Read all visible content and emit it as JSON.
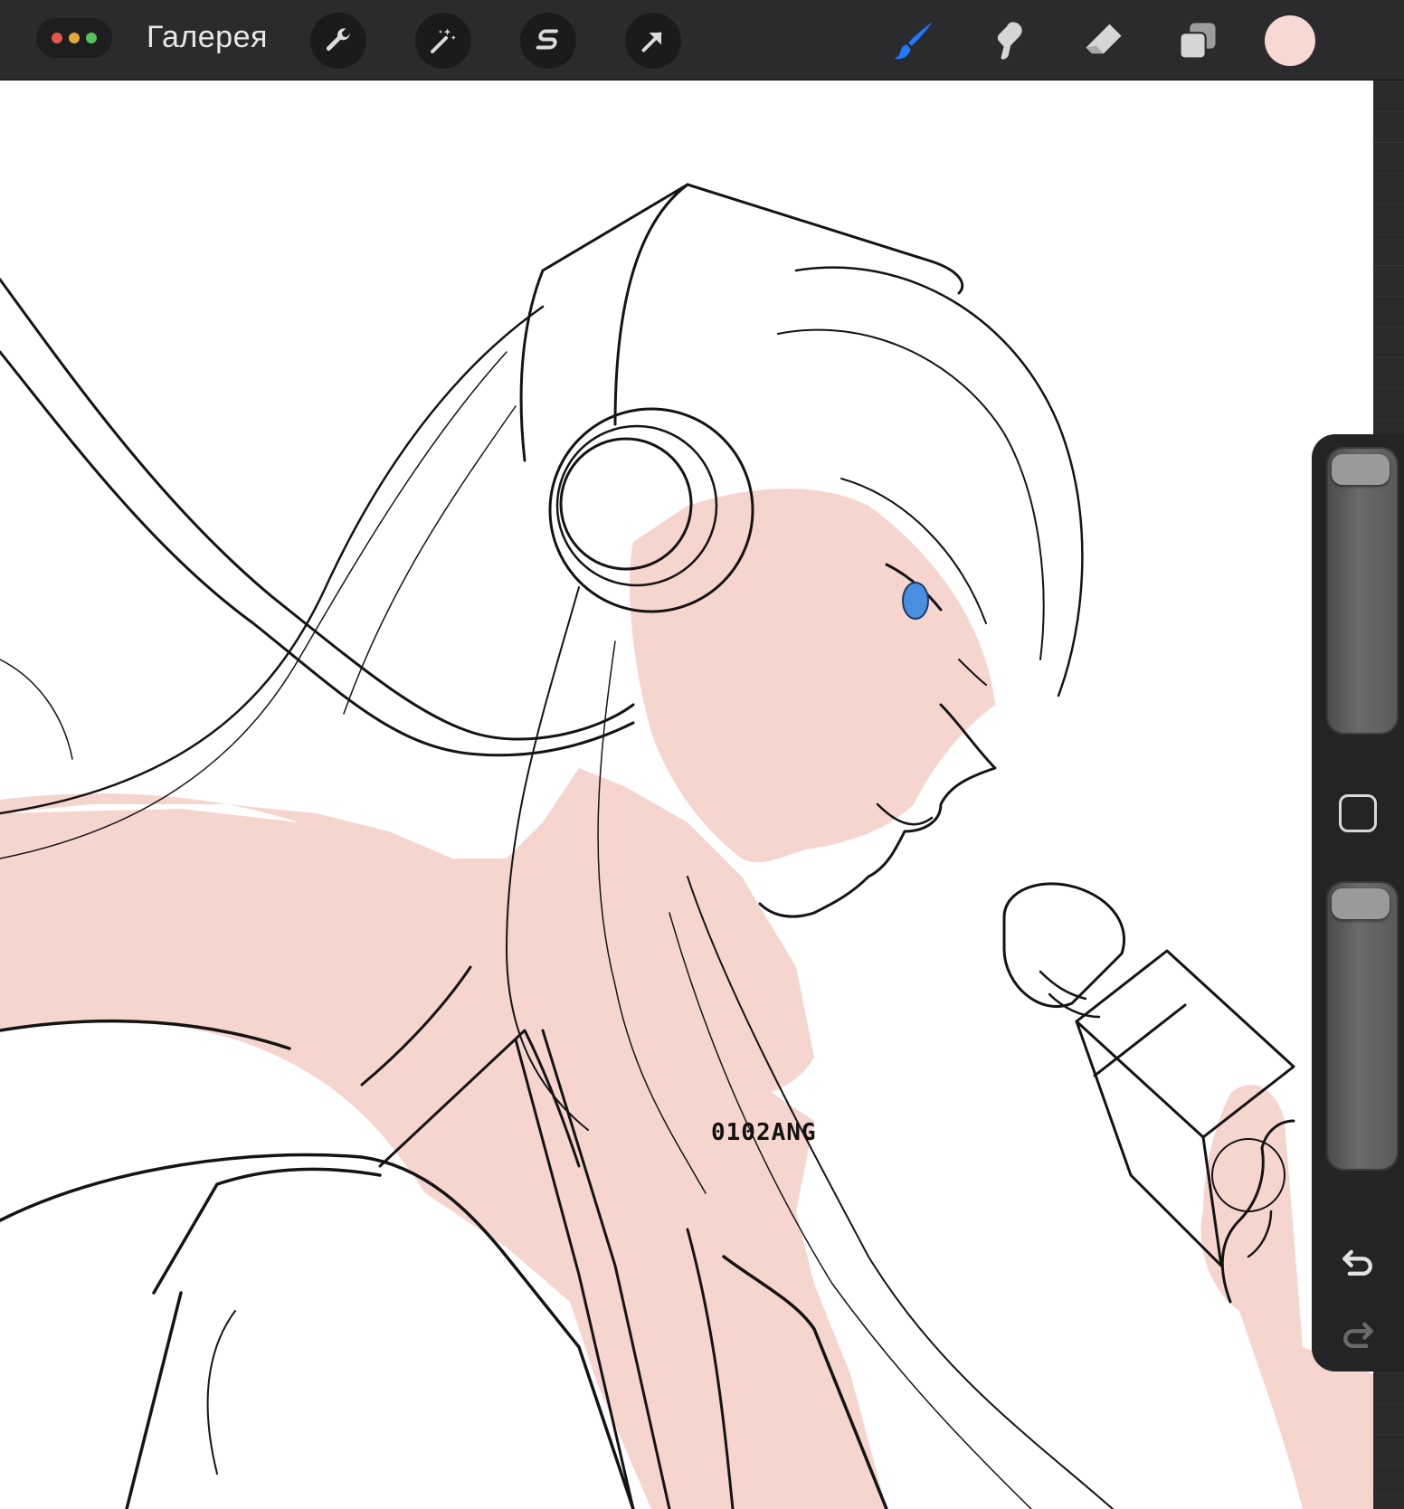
{
  "toolbar": {
    "gallery_label": "Галерея",
    "traffic_colors": [
      "#e5564e",
      "#e3a83a",
      "#5ac25a"
    ],
    "left_tools": [
      "wrench-icon",
      "magic-wand-icon",
      "selection-s-icon",
      "transform-arrow-icon"
    ],
    "right_tools": [
      "brush-icon",
      "smudge-icon",
      "eraser-icon",
      "layers-icon"
    ],
    "active_tool": "brush",
    "active_color": "#1e7bff",
    "current_color": "#f8d8d2"
  },
  "canvas": {
    "watermark": "0102ANG"
  },
  "side_panel": {
    "brush_size_level": 0.0,
    "opacity_level": 0.0
  }
}
